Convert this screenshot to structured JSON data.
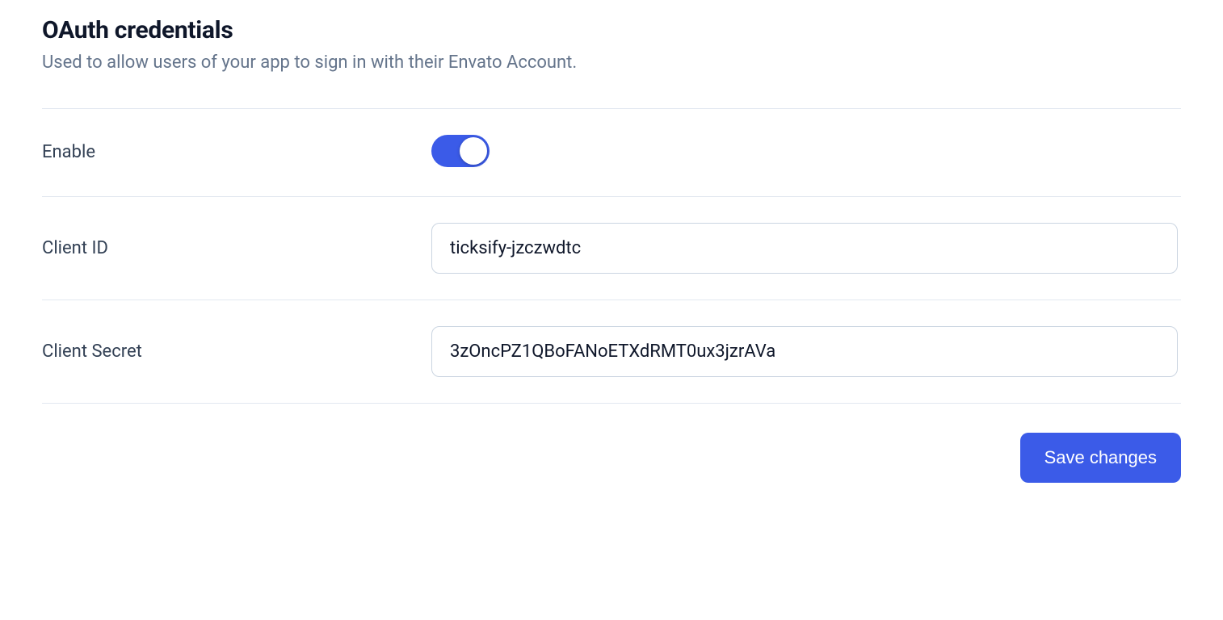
{
  "section": {
    "title": "OAuth credentials",
    "description": "Used to allow users of your app to sign in with their Envato Account."
  },
  "fields": {
    "enable": {
      "label": "Enable",
      "value": true
    },
    "clientId": {
      "label": "Client ID",
      "value": "ticksify-jzczwdtc"
    },
    "clientSecret": {
      "label": "Client Secret",
      "value": "3zOncPZ1QBoFANoETXdRMT0ux3jzrAVa"
    }
  },
  "actions": {
    "save": "Save changes"
  }
}
